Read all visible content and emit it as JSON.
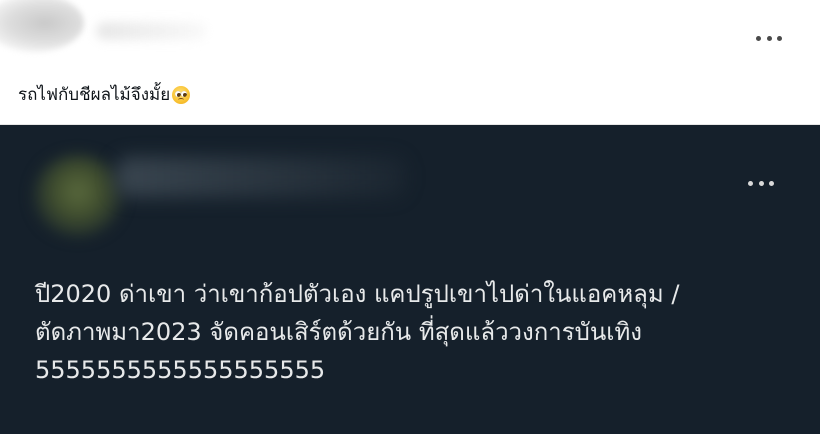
{
  "outer_tweet": {
    "text": "รถไฟกับชีผลไม้จึงมั้ย",
    "emoji": "pleading-face-icon",
    "more_icon": "more-icon"
  },
  "quoted_tweet": {
    "lines": [
      "ปี2020 ด่าเขา ว่าเขาก้อปตัวเอง แคปรูปเขาไปด่าในแอคหลุม /",
      "ตัดภาพมา2023 จัดคอนเสิร์ตด้วยกัน ที่สุดแล้ววงการบันเทิง",
      "5555555555555555555"
    ],
    "more_icon": "more-icon"
  },
  "colors": {
    "outer_background": "#ffffff",
    "quoted_background": "#15202b",
    "quoted_text": "#e7e9ea",
    "outer_text": "#0f1419"
  }
}
